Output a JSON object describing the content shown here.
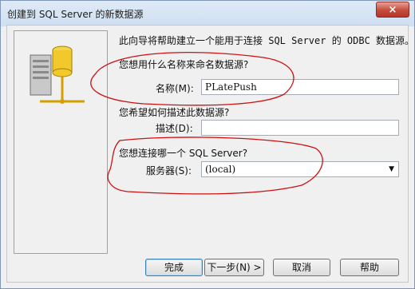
{
  "window": {
    "title": "创建到 SQL Server 的新数据源",
    "close_label": "×"
  },
  "wizard": {
    "intro": "此向导将帮助建立一个能用于连接 SQL Server 的 ODBC 数据源。",
    "q_name": "您想用什么名称来命名数据源?",
    "name_label": "名称(M):",
    "name_value": "PLatePush",
    "q_desc": "您希望如何描述此数据源?",
    "desc_label": "描述(D):",
    "desc_value": "",
    "q_server": "您想连接哪一个 SQL Server?",
    "server_label": "服务器(S):",
    "server_value": "(local)"
  },
  "buttons": {
    "finish": "完成",
    "next": "下一步(N) >",
    "cancel": "取消",
    "help": "帮助"
  },
  "icons": {
    "close": "close-icon",
    "illustration": "database-server-icon",
    "dropdown": "chevron-down-icon"
  },
  "colors": {
    "annotation": "#cc1111",
    "title_gradient": "#cfdff2"
  }
}
